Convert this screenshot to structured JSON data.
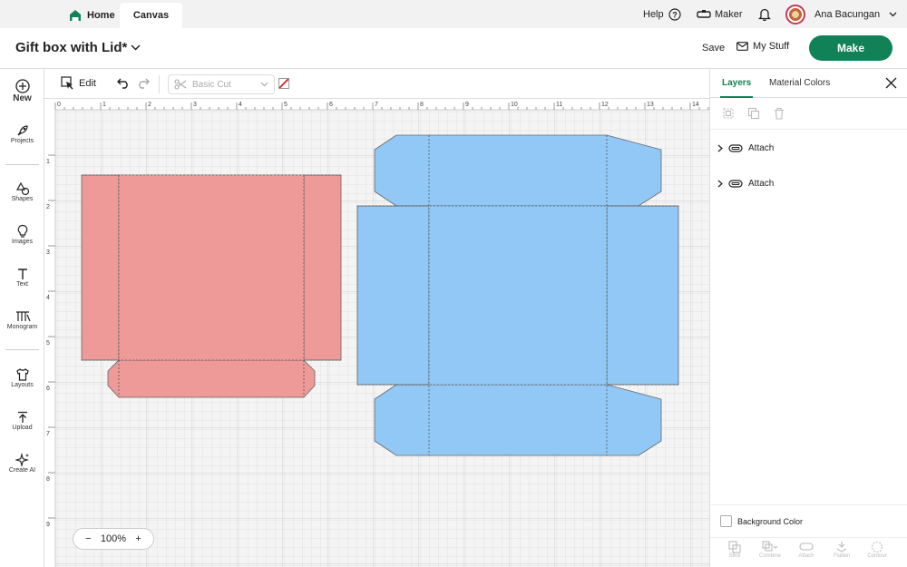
{
  "top_nav": {
    "home_label": "Home",
    "canvas_label": "Canvas",
    "help_label": "Help",
    "maker_label": "Maker",
    "user_name": "Ana Bacungan"
  },
  "title_bar": {
    "project_title": "Gift box with Lid*",
    "save_label": "Save",
    "mystuff_label": "My Stuff",
    "make_label": "Make"
  },
  "left_bar": {
    "new": "New",
    "projects": "Projects",
    "shapes": "Shapes",
    "images": "Images",
    "text": "Text",
    "monogram": "Monogram",
    "layouts": "Layouts",
    "upload": "Upload",
    "create_ai": "Create AI"
  },
  "toolbar": {
    "edit_label": "Edit",
    "operation_placeholder": "Basic Cut"
  },
  "canvas": {
    "ruler_x": [
      "0",
      "1",
      "2",
      "3",
      "4",
      "5",
      "6",
      "7",
      "8",
      "9",
      "10",
      "11",
      "12",
      "13",
      "14"
    ],
    "ruler_y": [
      "1",
      "2",
      "3",
      "4",
      "5",
      "6",
      "7",
      "8",
      "9"
    ],
    "zoom_label": "100%",
    "shape_colors": {
      "pink": "#ed9a98",
      "blue": "#92c8f5"
    }
  },
  "right_panel": {
    "tab_layers": "Layers",
    "tab_material_colors": "Material Colors",
    "layers": [
      {
        "label": "Attach"
      },
      {
        "label": "Attach"
      }
    ],
    "background_color_label": "Background Color",
    "bottom_actions": [
      "Slice",
      "Combine",
      "Attach",
      "Flatten",
      "Contour"
    ]
  },
  "colors": {
    "accent": "#118257"
  }
}
